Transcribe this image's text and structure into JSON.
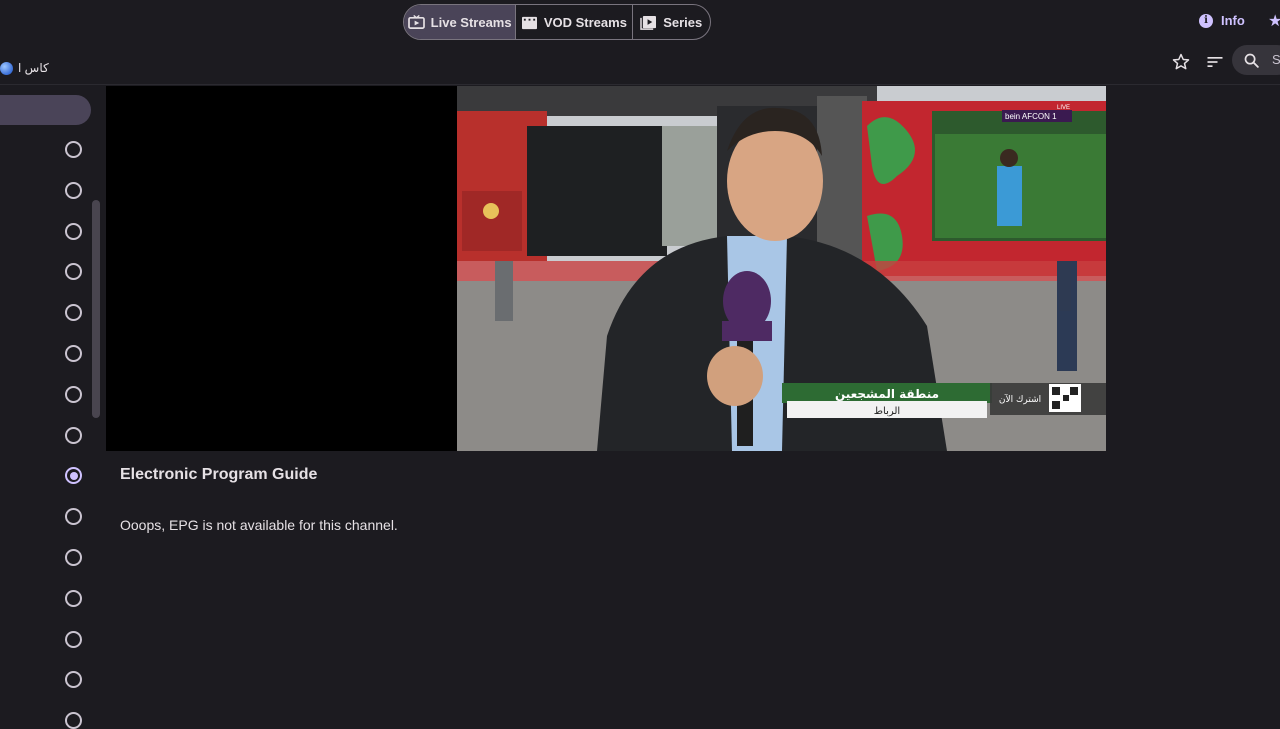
{
  "tabs": [
    {
      "label": "Live Streams",
      "icon": "tv-icon",
      "active": true
    },
    {
      "label": "VOD Streams",
      "icon": "movie-icon",
      "active": false
    },
    {
      "label": "Series",
      "icon": "play-library-icon",
      "active": false
    }
  ],
  "top_right": {
    "info_label": "Info",
    "star_icon": "star-icon"
  },
  "toolbar": {
    "channel_title": "كاس ا",
    "favorite_icon": "star-outline-icon",
    "sort_icon": "sort-icon",
    "search_icon": "search-icon",
    "search_partial": "S"
  },
  "sidebar": {
    "radios": [
      false,
      false,
      false,
      false,
      false,
      false,
      false,
      false,
      true,
      false,
      false,
      false,
      false,
      false,
      false
    ]
  },
  "video": {
    "caption_title": "منطقة المشجعين",
    "caption_subtitle": "الرباط",
    "subscribe_text": "اشترك الآن",
    "logo_text": "bein AFCON 1",
    "live_tag": "LIVE"
  },
  "epg": {
    "title": "Electronic Program Guide",
    "message": "Ooops, EPG is not available for this channel."
  },
  "colors": {
    "background": "#1c1b20",
    "accent": "#cfc2ff",
    "active_segment": "#4a4458"
  }
}
